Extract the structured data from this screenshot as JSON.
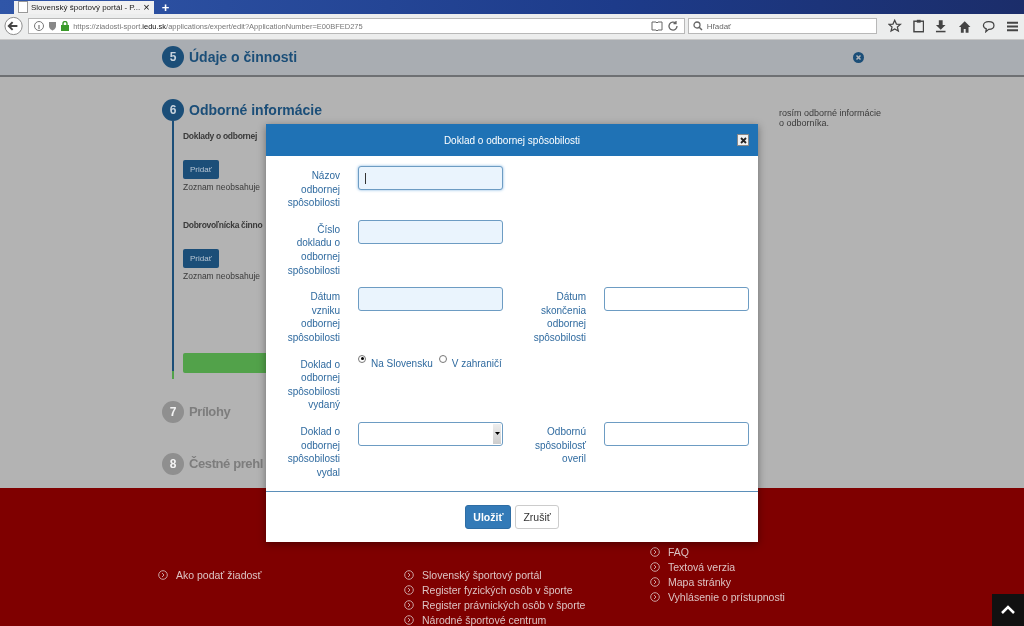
{
  "browser": {
    "tab_title": "Slovenský športový portál - P...",
    "tab_close": "×",
    "new_tab": "+",
    "url_prefix": "https://ziadosti-sport.",
    "url_domain": "iedu.sk",
    "url_rest": "/applications/expert/edit?ApplicationNumber=E00BFED275",
    "search_placeholder": "Hľadať"
  },
  "sections": [
    {
      "number": "5",
      "title": "Údaje o činnosti",
      "kind": "bar"
    },
    {
      "number": "6",
      "title": "Odborné informácie",
      "kind": "active"
    },
    {
      "number": "7",
      "title": "Prílohy",
      "kind": "inactive"
    },
    {
      "number": "8",
      "title": "Čestné prehl",
      "kind": "inactive"
    }
  ],
  "subsections": [
    {
      "title": "Doklady o odbornej",
      "button": "Pridať",
      "empty_text": "Zoznam neobsahuje"
    },
    {
      "title": "Dobrovoľnícka činno",
      "button": "Pridať",
      "empty_text": "Zoznam neobsahuje"
    }
  ],
  "side_note": [
    "rosím odborné informácie",
    "o odborníka."
  ],
  "modal": {
    "title": "Doklad o odbornej spôsobilosti",
    "rows": [
      {
        "left": {
          "label": "Názov odbornej spôsobilosti",
          "kind": "text",
          "focused": true
        }
      },
      {
        "left": {
          "label": "Číslo dokladu o odbornej spôsobilosti",
          "kind": "text",
          "focused": false
        }
      },
      {
        "left": {
          "label": "Dátum vzniku odbornej spôsobilosti",
          "kind": "date",
          "focused": false
        },
        "right": {
          "label": "Dátum skončenia odbornej spôsobilosti",
          "kind": "plain",
          "focused": false
        }
      },
      {
        "left": {
          "label": "Doklad o odbornej spôsobilosti vydaný",
          "kind": "radio",
          "options": [
            {
              "label": "Na Slovensku",
              "selected": true
            },
            {
              "label": "V zahraničí",
              "selected": false
            }
          ]
        }
      },
      {
        "left": {
          "label": "Doklad o odbornej spôsobilosti vydal",
          "kind": "select",
          "focused": false
        },
        "right": {
          "label": "Odbornú spôsobilosť overil",
          "kind": "plain",
          "focused": false
        }
      }
    ],
    "buttons": [
      {
        "label": "Uložiť",
        "kind": "primary"
      },
      {
        "label": "Zrušiť",
        "kind": "default"
      }
    ]
  },
  "footer": {
    "columns": [
      {
        "links": [
          "Ako podať žiadosť"
        ]
      },
      {
        "links": [
          "Slovenský športový portál",
          "Register fyzických osôb v športe",
          "Register právnických osôb v športe",
          "Národné športové centrum"
        ]
      },
      {
        "links": [
          "FAQ",
          "Textová verzia",
          "Mapa stránky",
          "Vyhlásenie o prístupnosti"
        ]
      }
    ]
  }
}
